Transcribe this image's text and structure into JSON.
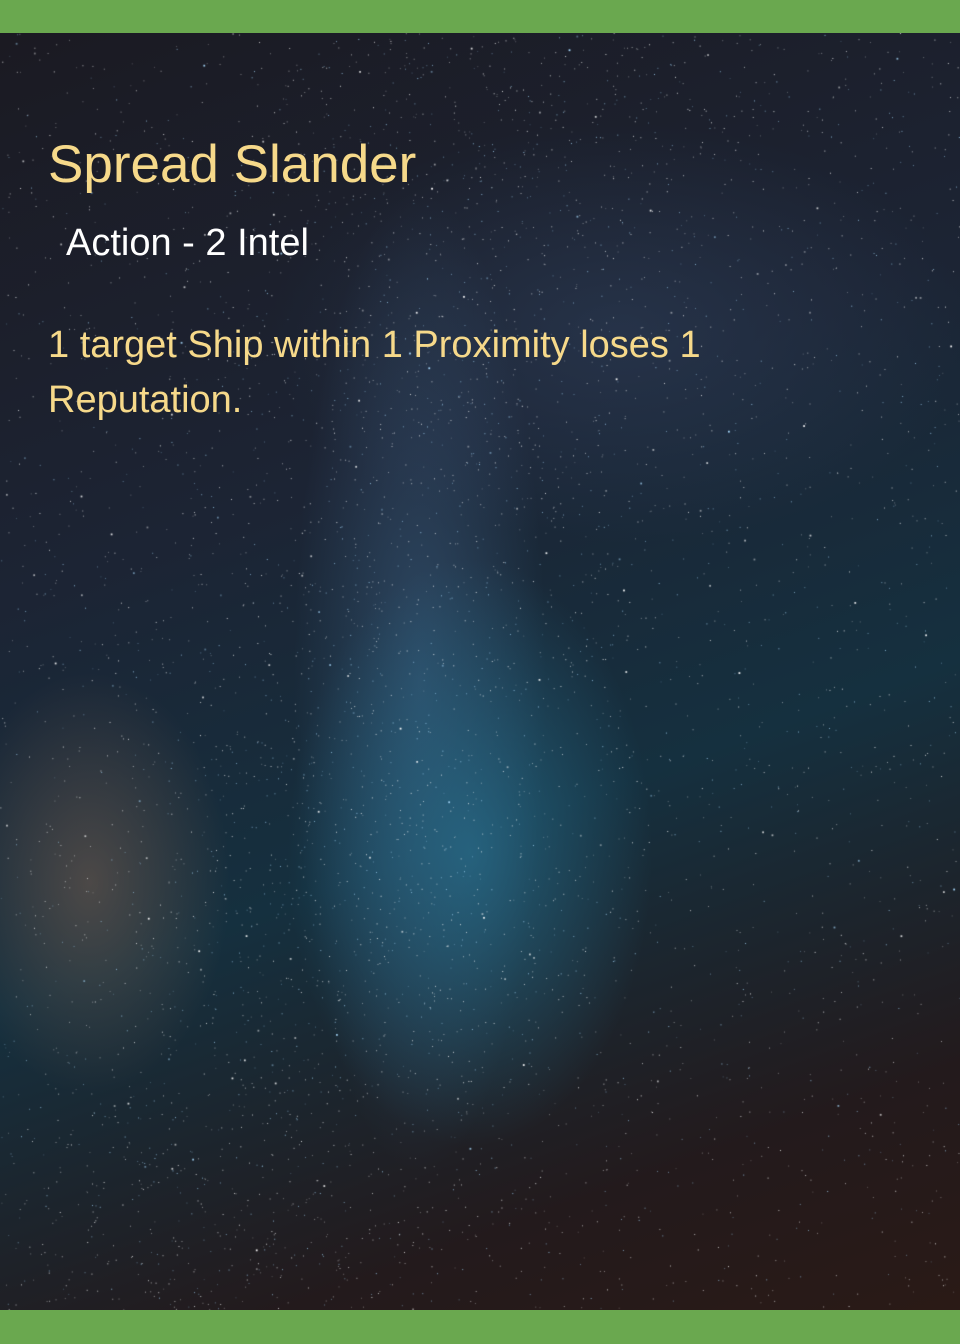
{
  "card": {
    "title": "Spread Slander",
    "type_cost": "Action - 2 Intel",
    "effect": "1 target Ship within 1 Proximity loses 1 Reputation."
  },
  "colors": {
    "frame": "#6aa84f",
    "title_text": "#f6d98a",
    "subtitle_text": "#ffffff",
    "effect_text": "#f6d98a"
  }
}
